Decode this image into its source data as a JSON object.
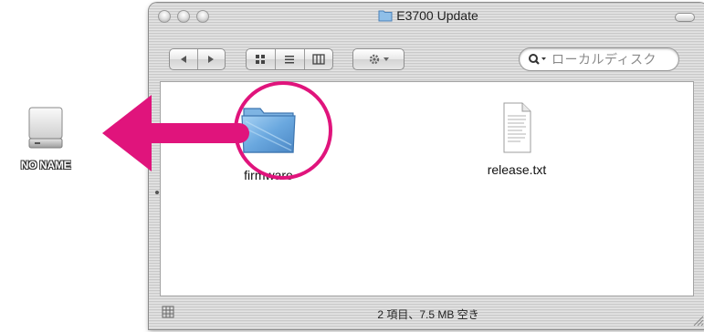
{
  "desktop": {
    "drive_label": "NO NAME",
    "drive_icon": "external-drive-icon"
  },
  "window": {
    "title": "E3700 Update",
    "title_icon": "folder-icon",
    "toolbar": {
      "back_icon": "back-arrow-icon",
      "forward_icon": "forward-arrow-icon",
      "view_icons": [
        "icon-view-icon",
        "list-view-icon",
        "column-view-icon"
      ],
      "action_icon": "gear-icon",
      "search_placeholder": "ローカルディスク"
    },
    "items": [
      {
        "label": "firmware",
        "icon": "folder-icon"
      },
      {
        "label": "release.txt",
        "icon": "text-document-icon"
      }
    ],
    "status": "2 項目、7.5 MB 空き"
  },
  "annotation": {
    "arrow_color": "#e0147c",
    "highlight_color": "#e0147c"
  }
}
